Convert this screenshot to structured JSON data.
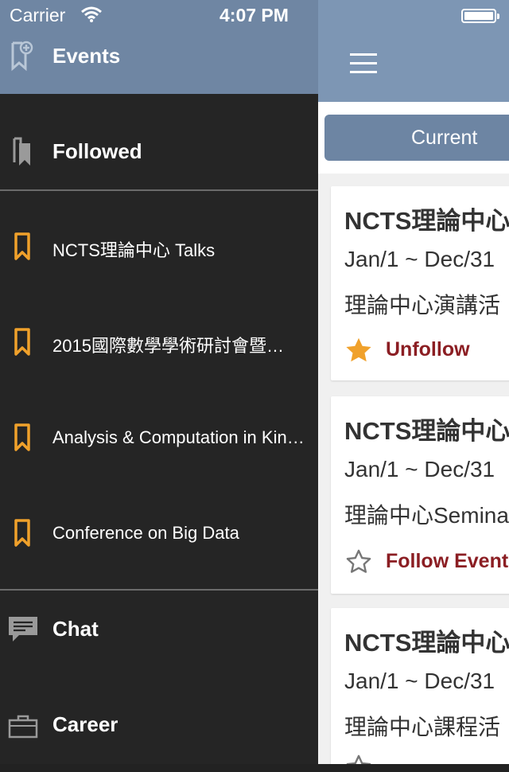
{
  "status_bar": {
    "carrier": "Carrier",
    "time": "4:07 PM"
  },
  "drawer": {
    "header_title": "Events",
    "followed_label": "Followed",
    "events": [
      {
        "label": "NCTS理論中心 Talks"
      },
      {
        "label": "2015國際數學學術研討會暨…"
      },
      {
        "label": "Analysis & Computation in Kin…"
      },
      {
        "label": "Conference on Big Data"
      }
    ],
    "chat_label": "Chat",
    "career_label": "Career"
  },
  "main": {
    "segment_current": "Current",
    "cards": [
      {
        "title": "NCTS理論中心",
        "date": "Jan/1 ~ Dec/31",
        "desc": "理論中心演講活",
        "follow_label": "Unfollow",
        "followed": true
      },
      {
        "title": "NCTS理論中心",
        "date": "Jan/1 ~ Dec/31",
        "desc": "理論中心Semina",
        "follow_label": "Follow Event",
        "followed": false
      },
      {
        "title": "NCTS理論中心",
        "date": "Jan/1 ~ Dec/31",
        "desc": "理論中心課程活",
        "follow_label": "",
        "followed": false
      }
    ]
  },
  "colors": {
    "accent_orange": "#f0a12b",
    "navbar_blue": "#7d96b4",
    "follow_red": "#8b1e23"
  }
}
